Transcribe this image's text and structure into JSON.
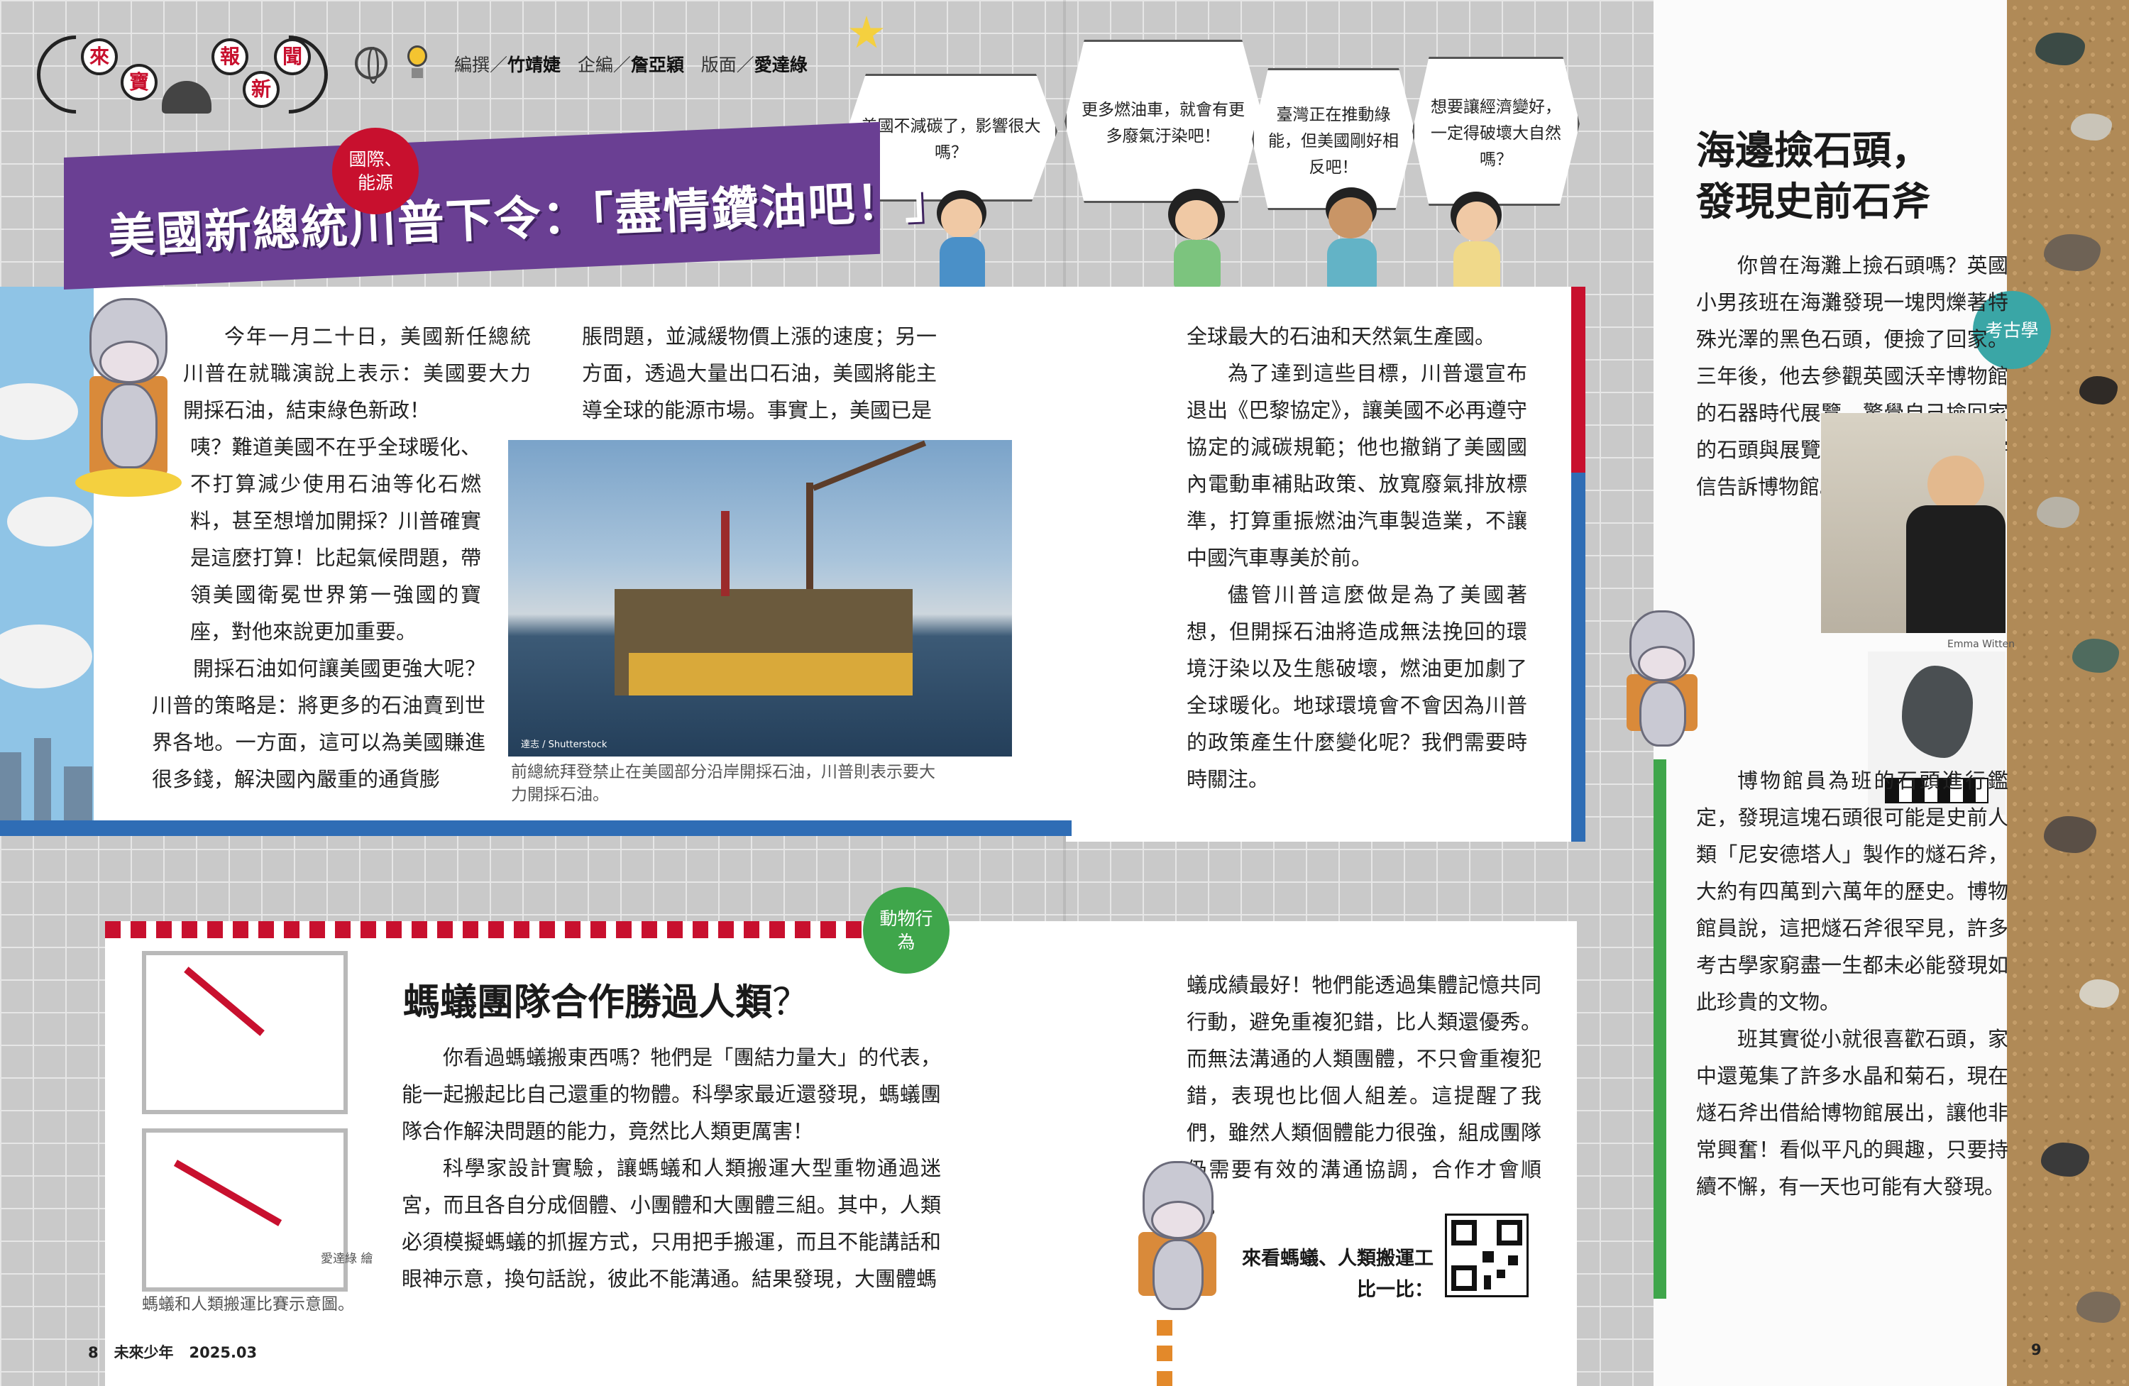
{
  "masthead": {
    "title_chars": [
      "來",
      "寶",
      "報",
      "新",
      "聞"
    ],
    "credits_editor_label": "編撰／",
    "credits_editor": "竹靖婕",
    "credits_planner_label": "企編／",
    "credits_planner": "詹亞穎",
    "credits_layout_label": "版面／",
    "credits_layout": "愛達綠"
  },
  "bubbles": [
    "美國不減碳了，影響很大嗎？",
    "更多燃油車，就會有更多廢氣汙染吧！",
    "臺灣正在推動綠能，但美國剛好相反吧！",
    "想要讓經濟變好，一定得破壞大自然嗎？"
  ],
  "article1": {
    "badge": "國際、能源",
    "title": "美國新總統川普下令：「盡情鑽油吧！」",
    "col1": [
      "今年一月二十日，美國新任總統川普在就職演說上表示：美國要大力開採石油，結束綠色新政！",
      "咦？難道美國不在乎全球暖化、不打算減少使用石油等化石燃料，甚至想增加開採？川普確實是這麼打算！比起氣候問題，帶領美國衛冕世界第一強國的寶座，對他來說更加重要。",
      "開採石油如何讓美國更強大呢？川普的策略是：將更多的石油賣到世界各地。一方面，這可以為美國賺進很多錢，解決國內嚴重的通貨膨"
    ],
    "col2": "脹問題，並減緩物價上漲的速度；另一方面，透過大量出口石油，美國將能主導全球的能源市場。事實上，美國已是",
    "col3": [
      "全球最大的石油和天然氣生產國。",
      "為了達到這些目標，川普還宣布退出《巴黎協定》，讓美國不必再遵守協定的減碳規範；他也撤銷了美國國內電動車補貼政策、放寬廢氣排放標準，打算重振燃油汽車製造業，不讓中國汽車專美於前。",
      "儘管川普這麼做是為了美國著想，但開採石油將造成無法挽回的環境汙染以及生態破壞，燃油更加劇了全球暖化。地球環境會不會因為川普的政策產生什麼變化呢？我們需要時時關注。"
    ],
    "photo_credit": "達志 / Shutterstock",
    "photo_caption": "前總統拜登禁止在美國部分沿岸開採石油，川普則表示要大力開採石油。"
  },
  "article2": {
    "badge": "動物行為",
    "title": "螞蟻團隊合作勝過人類",
    "title_mark": "？",
    "col1": [
      "你看過螞蟻搬東西嗎？牠們是「團結力量大」的代表，能一起搬起比自己還重的物體。科學家最近還發現，螞蟻團隊合作解決問題的能力，竟然比人類更厲害！",
      "科學家設計實驗，讓螞蟻和人類搬運大型重物通過迷宮，而且各自分成個體、小團體和大團體三組。其中，人類必須模擬螞蟻的抓握方式，只用把手搬運，而且不能講話和眼神示意，換句話說，彼此不能溝通。結果發現，大團體螞"
    ],
    "col2": [
      "蟻成績最好！牠們能透過集體記憶共同行動，避免重複犯錯，比人類還優秀。而無法溝通的人類團體，不只會重複犯錯，表現也比個人組差。這提醒了我們，雖然人類個體能力很強，組成團隊仍需要有效的溝通協調，合作才會順利。"
    ],
    "illus_credit": "愛達綠 繪",
    "illus_caption": "螞蟻和人類搬運比賽示意圖。",
    "qr_label_line1": "來看螞蟻、人類搬運工",
    "qr_label_line2": "比一比："
  },
  "article3": {
    "badge": "考古學",
    "title_line1": "海邊撿石頭，",
    "title_line2": "發現史前石斧",
    "paras": [
      "你曾在海灘上撿石頭嗎？英國小男孩班在海灘發現一塊閃爍著特殊光澤的黑色石頭，便撿了回家。三年後，他去參觀英國沃辛博物館的石器時代展覽，驚覺自己撿回家的石頭與展覽文物很相似，於是寄信告訴博物館。",
      "博物館員為班的石頭進行鑑定，發現這塊石頭很可能是史前人類「尼安德塔人」製作的燧石斧，大約有四萬到六萬年的歷史。博物館員說，這把燧石斧很罕見，許多考古學家窮盡一生都未必能發現如此珍貴的文物。",
      "班其實從小就很喜歡石頭，家中還蒐集了許多水晶和菊石，現在燧石斧出借給博物館展出，讓他非常興奮！看似平凡的興趣，只要持續不懈，有一天也可能有大發現。"
    ],
    "photo_credit": "Emma Witten"
  },
  "footer": {
    "left_page": "8",
    "magazine": "未來少年",
    "issue": "2025.03",
    "right_page": "9"
  },
  "colors": {
    "purple": "#6a3f93",
    "red": "#c8102e",
    "blue": "#2f6db5",
    "green": "#3fa64b",
    "teal": "#3aa6a6"
  }
}
